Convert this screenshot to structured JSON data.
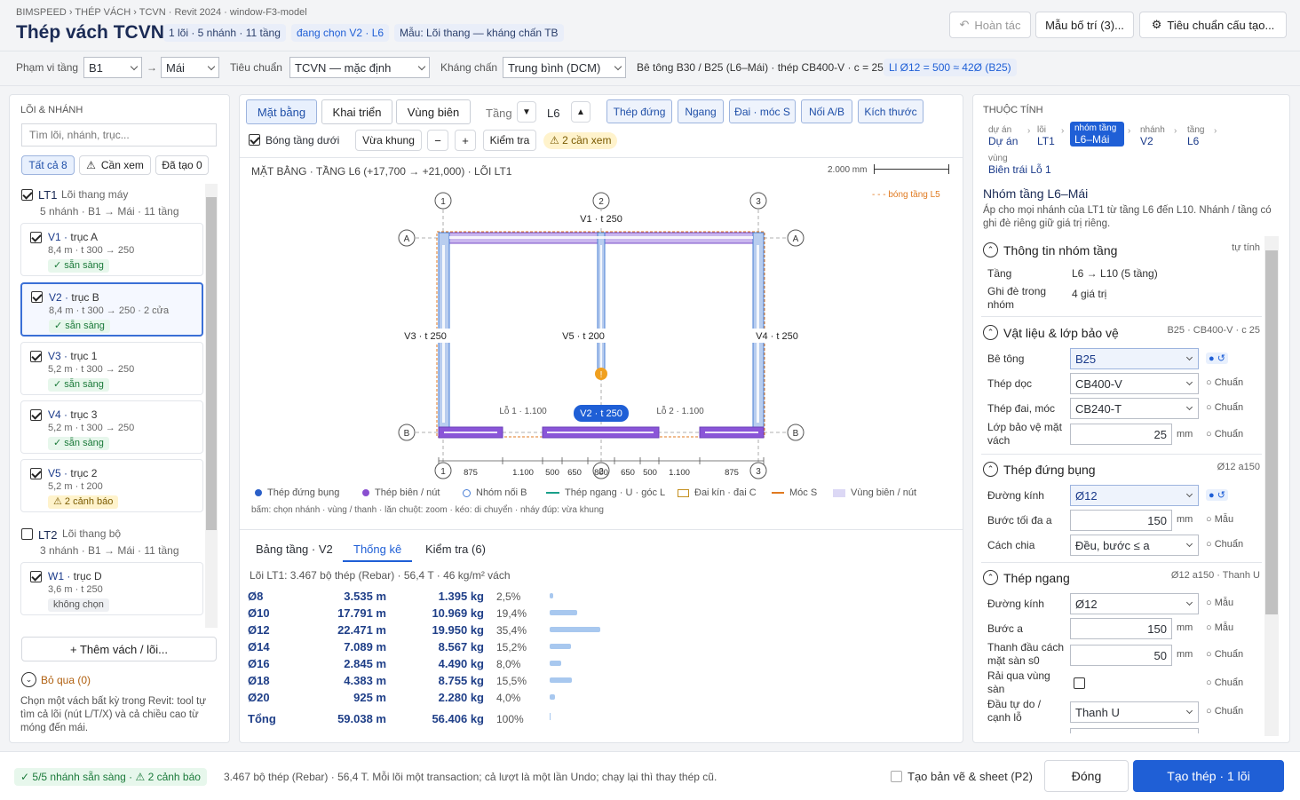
{
  "header": {
    "breadcrumb": "BIMSPEED › THÉP VÁCH › TCVN · Revit 2024 · window-F3-model",
    "title": "Thép vách TCVN",
    "chips": [
      "1 lõi · 5 nhánh · 11 tầng",
      "đang chọn V2 · L6",
      "Mẫu: Lõi thang — kháng chấn TB"
    ],
    "undo": "Hoàn tác",
    "layout_template": "Mẫu bố trí (3)...",
    "standard_btn": "Tiêu chuẩn cấu tạo..."
  },
  "toolbar": {
    "floor_range_label": "Phạm vi tầng",
    "floor_from": "B1",
    "floor_to": "Mái",
    "arrow": "→",
    "standard_label": "Tiêu chuẩn",
    "standard_value": "TCVN — mặc định",
    "seismic_label": "Kháng chấn",
    "seismic_value": "Trung bình (DCM)",
    "material_info": "Bê tông B30 / B25 (L6–Mái) · thép CB400-V · c = 25",
    "lap_info": "Ll Ø12 = 500 ≈ 42Ø (B25)"
  },
  "left": {
    "section_title": "LÕI & NHÁNH",
    "search_placeholder": "Tìm lõi, nhánh, trục...",
    "filters": [
      "Tất cả 8",
      "Cần xem",
      "Đã tạo 0"
    ],
    "cores": [
      {
        "id": "LT1",
        "name": "Lõi thang máy",
        "sub": "5 nhánh · B1 → Mái · 11 tầng"
      },
      {
        "id": "LT2",
        "name": "Lõi thang bộ",
        "sub": "3 nhánh · B1 → Mái · 11 tầng"
      }
    ],
    "walls": [
      {
        "id": "V1",
        "axis": "trục A",
        "sub": "8,4 m · t 300 → 250",
        "badge": "✓ sẵn sàng"
      },
      {
        "id": "V2",
        "axis": "trục B",
        "sub": "8,4 m · t 300 → 250 · 2 cửa",
        "badge": "✓ sẵn sàng"
      },
      {
        "id": "V3",
        "axis": "trục 1",
        "sub": "5,2 m · t 300 → 250",
        "badge": "✓ sẵn sàng"
      },
      {
        "id": "V4",
        "axis": "trục 3",
        "sub": "5,2 m · t 300 → 250",
        "badge": "✓ sẵn sàng"
      },
      {
        "id": "V5",
        "axis": "trục 2",
        "sub": "5,2 m · t 200",
        "badge": "2 cảnh báo"
      },
      {
        "id": "W1",
        "axis": "trục D",
        "sub": "3,6 m · t 250",
        "badge": "không chọn"
      }
    ],
    "add_btn": "+ Thêm vách / lõi...",
    "skip": "Bỏ qua (0)",
    "hint": "Chọn một vách bất kỳ trong Revit: tool tự tìm cả lõi (nút L/T/X) và cả chiều cao từ móng đến mái."
  },
  "center": {
    "tabs": [
      "Mặt bằng",
      "Khai triển",
      "Vùng biên"
    ],
    "floor_label": "Tầng",
    "floor_value": "L6",
    "types": [
      "Thép đứng",
      "Ngang",
      "Đai · móc S",
      "Nối A/B",
      "Kích thước"
    ],
    "shadow_cb": "Bóng tầng dưới",
    "fit": "Vừa khung",
    "minus": "−",
    "plus": "+",
    "check": "Kiểm tra",
    "warn_chip": "2 cần xem",
    "plan_title": "MẶT BẰNG · TẦNG L6 (+17,700 → +21,000) · LÕI LT1",
    "scale": "2.000 mm",
    "shadow_note": "- - - bóng tầng L5",
    "grids": [
      "1",
      "2",
      "3",
      "A",
      "B"
    ],
    "wall_labels": [
      "V1 · t 250",
      "V3 · t 250",
      "V5 · t 200",
      "V4 · t 250",
      "V2 · t 250"
    ],
    "openings": [
      "Lỗ 1 · 1.100",
      "Lỗ 2 · 1.100"
    ],
    "dims": [
      "875",
      "1.100",
      "500",
      "650",
      "800",
      "650",
      "500",
      "1.100",
      "875"
    ],
    "legend": [
      "Thép đứng bụng",
      "Thép biên / nút",
      "Nhóm nối B",
      "Thép ngang · U · góc L",
      "Đai kín · đai C",
      "Móc S",
      "Vùng biên / nút"
    ],
    "mouse_hint": "bấm: chọn nhánh · vùng / thanh · lăn chuột: zoom · kéo: di chuyển · nháy đúp: vừa khung",
    "bottom_tabs": [
      "Bảng tầng · V2",
      "Thống kê",
      "Kiểm tra (6)"
    ],
    "stats_summary": "Lõi LT1: 3.467 bộ thép (Rebar) · 56,4 T · 46 kg/m² vách",
    "stats": [
      {
        "d": "Ø8",
        "len": "3.535 m",
        "kg": "1.395 kg",
        "pct": "2,5%",
        "frac": 0.025
      },
      {
        "d": "Ø10",
        "len": "17.791 m",
        "kg": "10.969 kg",
        "pct": "19,4%",
        "frac": 0.194
      },
      {
        "d": "Ø12",
        "len": "22.471 m",
        "kg": "19.950 kg",
        "pct": "35,4%",
        "frac": 0.354
      },
      {
        "d": "Ø14",
        "len": "7.089 m",
        "kg": "8.567 kg",
        "pct": "15,2%",
        "frac": 0.152
      },
      {
        "d": "Ø16",
        "len": "2.845 m",
        "kg": "4.490 kg",
        "pct": "8,0%",
        "frac": 0.08
      },
      {
        "d": "Ø18",
        "len": "4.383 m",
        "kg": "8.755 kg",
        "pct": "15,5%",
        "frac": 0.155
      },
      {
        "d": "Ø20",
        "len": "925 m",
        "kg": "2.280 kg",
        "pct": "4,0%",
        "frac": 0.04
      },
      {
        "d": "Tổng",
        "len": "59.038 m",
        "kg": "56.406 kg",
        "pct": "100%",
        "frac": 0.0
      }
    ]
  },
  "right": {
    "section_title": "THUỘC TÍNH",
    "crumbs": [
      {
        "k": "dự án",
        "v": "Dự án"
      },
      {
        "k": "lõi",
        "v": "LT1"
      },
      {
        "k": "nhóm tầng",
        "v": "L6–Mái"
      },
      {
        "k": "nhánh",
        "v": "V2"
      },
      {
        "k": "tầng",
        "v": "L6"
      },
      {
        "k": "vùng",
        "v": "Biên trái Lỗ 1"
      }
    ],
    "group_title": "Nhóm tầng L6–Mái",
    "group_desc": "Áp cho mọi nhánh của LT1 từ tầng L6 đến L10. Nhánh / tầng có ghi đè riêng giữ giá trị riêng.",
    "s1": {
      "title": "Thông tin nhóm tầng",
      "right": "tự tính",
      "floors_label": "Tầng",
      "floors": "L6 → L10 (5 tầng)",
      "over_label": "Ghi đè trong nhóm",
      "over": "4 giá trị"
    },
    "s2": {
      "title": "Vật liệu & lớp bảo vệ",
      "right": "B25 · CB400-V · c 25",
      "rows": [
        {
          "l": "Bê tông",
          "v": "B25",
          "o": "● ↺"
        },
        {
          "l": "Thép dọc",
          "v": "CB400-V",
          "o": "○ Chuẩn"
        },
        {
          "l": "Thép đai, móc",
          "v": "CB240-T",
          "o": "○ Chuẩn"
        },
        {
          "l": "Lớp bảo vệ mặt vách",
          "v": "25",
          "u": "mm",
          "o": "○ Chuẩn"
        }
      ]
    },
    "s3": {
      "title": "Thép đứng bụng",
      "right": "Ø12 a150",
      "rows": [
        {
          "l": "Đường kính",
          "v": "Ø12",
          "o": "● ↺"
        },
        {
          "l": "Bước tối đa a",
          "v": "150",
          "u": "mm",
          "o": "○ Mẫu"
        },
        {
          "l": "Cách chia",
          "v": "Đều, bước ≤ a",
          "o": "○ Chuẩn"
        }
      ]
    },
    "s4": {
      "title": "Thép ngang",
      "right": "Ø12 a150 · Thanh U",
      "rows": [
        {
          "l": "Đường kính",
          "v": "Ø12",
          "o": "○ Mẫu"
        },
        {
          "l": "Bước a",
          "v": "150",
          "u": "mm",
          "o": "○ Mẫu"
        },
        {
          "l": "Thanh đầu cách mặt sàn s0",
          "v": "50",
          "u": "mm",
          "o": "○ Chuẩn"
        },
        {
          "l": "Rải qua vùng sàn",
          "o": "○ Chuẩn"
        },
        {
          "l": "Đầu tự do / cạnh lỗ",
          "v": "Thanh U",
          "o": "○ Chuẩn"
        }
      ]
    }
  },
  "footer": {
    "status": "✓ 5/5 nhánh sẵn sàng · ⚠ 2 cảnh báo",
    "info": "3.467 bộ thép (Rebar) · 56,4 T. Mỗi lõi một transaction; cả lượt là một lần Undo; chạy lại thì thay thép cũ.",
    "drawing_cb": "Tạo bản vẽ & sheet (P2)",
    "close": "Đóng",
    "create": "Tạo thép · 1 lõi"
  },
  "colors": {
    "accent": "#1f5fd6",
    "blue_rebar": "#4a7fd6",
    "purple_rebar": "#8a4fd0",
    "orange": "#e07a20"
  }
}
